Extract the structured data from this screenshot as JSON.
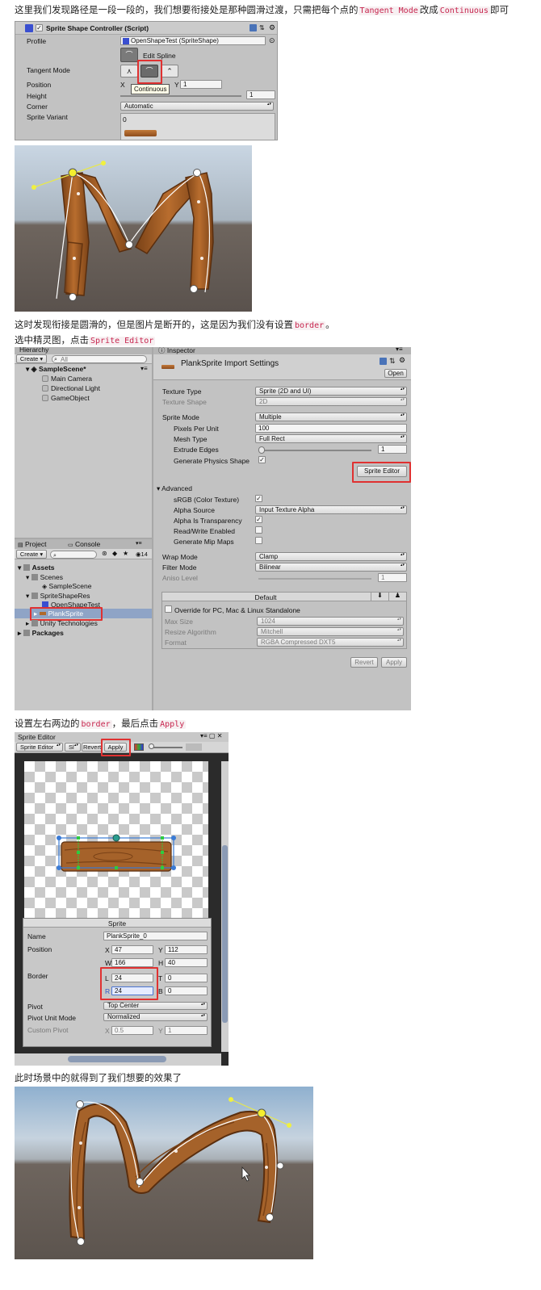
{
  "para1": {
    "a": "这里我们发现路径是一段一段的，我们想要衔接处是那种圆滑过渡，只需把每个点的",
    "code1": "Tangent Mode",
    "b": "改成",
    "code2": "Continuous",
    "c": "即可"
  },
  "shot1": {
    "title": "Sprite Shape Controller (Script)",
    "profile_label": "Profile",
    "profile_value": "OpenShapeTest (SpriteShape)",
    "edit_spline": "Edit Spline",
    "tangent_label": "Tangent Mode",
    "tooltip": "Continuous",
    "position_label": "Position",
    "pos_x_label": "X",
    "pos_x": "1",
    "pos_y_label": "Y",
    "pos_y": "1",
    "height_label": "Height",
    "height_value": "1",
    "corner_label": "Corner",
    "corner_value": "Automatic",
    "variant_label": "Sprite Variant",
    "variant_index": "0"
  },
  "para2": {
    "a": "这时发现衔接是圆滑的，但是图片是断开的，这是因为我们没有设置",
    "code": "border",
    "b": "。"
  },
  "para3": {
    "a": "选中精灵图，点击",
    "code": "Sprite Editor"
  },
  "shot3": {
    "hierarchy_tab": "Hierarchy",
    "create": "Create",
    "search_all": "All",
    "scene": "SampleScene*",
    "scene_items": [
      "Main Camera",
      "Directional Light",
      "GameObject"
    ],
    "project_tab": "Project",
    "console_tab": "Console",
    "create2": "Create",
    "count": "14",
    "assets": "Assets",
    "scenes": "Scenes",
    "sample_scene": "SampleScene",
    "res": "SpriteShapeRes",
    "open_shape": "OpenShapeTest",
    "plank": "PlankSprite",
    "unity_tech": "Unity Technologies",
    "packages": "Packages",
    "inspector_tab": "Inspector",
    "import_title": "PlankSprite Import Settings",
    "open_btn": "Open",
    "rows": [
      {
        "label": "Texture Type",
        "value": "Sprite (2D and UI)",
        "dis": false
      },
      {
        "label": "Texture Shape",
        "value": "2D",
        "dis": true
      }
    ],
    "sprite_mode_label": "Sprite Mode",
    "sprite_mode": "Multiple",
    "ppu_label": "Pixels Per Unit",
    "ppu": "100",
    "mesh_label": "Mesh Type",
    "mesh": "Full Rect",
    "extrude_label": "Extrude Edges",
    "extrude": "1",
    "physics_label": "Generate Physics Shape",
    "sprite_editor_btn": "Sprite Editor",
    "advanced": "Advanced",
    "srgb": "sRGB (Color Texture)",
    "alpha_src_label": "Alpha Source",
    "alpha_src": "Input Texture Alpha",
    "alpha_transp": "Alpha Is Transparency",
    "readwrite": "Read/Write Enabled",
    "mipmaps": "Generate Mip Maps",
    "wrap_label": "Wrap Mode",
    "wrap": "Clamp",
    "filter_label": "Filter Mode",
    "filter": "Bilinear",
    "aniso_label": "Aniso Level",
    "aniso": "1",
    "default_tab": "Default",
    "override": "Override for PC, Mac & Linux Standalone",
    "max_size_label": "Max Size",
    "max_size": "1024",
    "resize_label": "Resize Algorithm",
    "resize": "Mitchell",
    "format_label": "Format",
    "format": "RGBA Compressed DXT5",
    "revert": "Revert",
    "apply": "Apply"
  },
  "para4": {
    "a": "设置左右两边的",
    "code1": "border",
    "b": "，最后点击",
    "code2": "Apply"
  },
  "shot4": {
    "title": "Sprite Editor",
    "mode": "Sprite Editor",
    "sl": "Sl",
    "revert": "Revert",
    "apply": "Apply",
    "panel_title": "Sprite",
    "name_label": "Name",
    "name": "PlankSprite_0",
    "position_label": "Position",
    "x": "47",
    "y": "112",
    "w": "166",
    "h": "40",
    "border_label": "Border",
    "l": "24",
    "t": "0",
    "r": "24",
    "b": "0",
    "pivot_label": "Pivot",
    "pivot": "Top Center",
    "pivot_unit_label": "Pivot Unit Mode",
    "pivot_unit": "Normalized",
    "custom_pivot_label": "Custom Pivot",
    "cx": "0.5",
    "cy": "1",
    "lx": "X",
    "ly": "Y",
    "lw": "W",
    "lh": "H",
    "ll": "L",
    "lt": "T",
    "lr": "R",
    "lb": "B"
  },
  "para5": {
    "a": "此时场景中的就得到了我们想要的效果了"
  },
  "colors": {
    "accent_red": "#e03131",
    "code_red": "#c7254e",
    "wood": "#a5622a",
    "wood_dark": "#7a4217",
    "sky": "#a8bfd6",
    "ground": "#6a5e56"
  }
}
